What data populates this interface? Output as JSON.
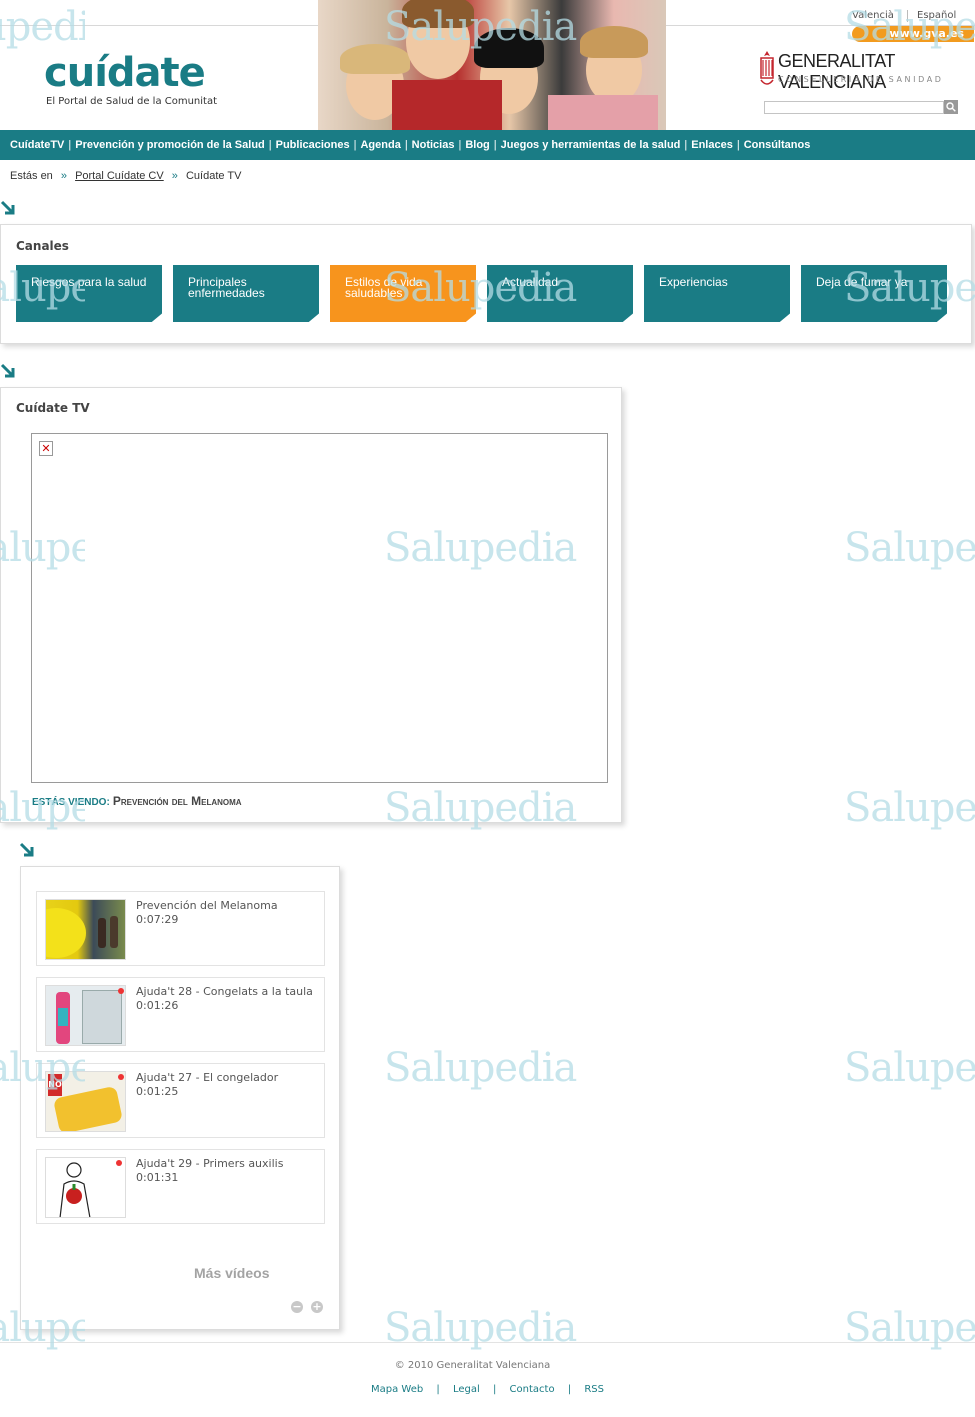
{
  "header": {
    "logo_title": "cuídate",
    "logo_subtitle": "El Portal de Salud de la Comunitat",
    "lang_valencia": "Valencià",
    "lang_espanol": "Español",
    "gva_link": "www.gva.es",
    "gv_title": "GENERALITAT VALENCIANA",
    "gv_subtitle": "CONSELLERIA DE SANIDAD",
    "search_placeholder": ""
  },
  "nav": {
    "items": [
      {
        "label": "CuídateTV"
      },
      {
        "label": "Prevención y promoción de la Salud"
      },
      {
        "label": "Publicaciones"
      },
      {
        "label": "Agenda"
      },
      {
        "label": "Noticias"
      },
      {
        "label": "Blog"
      },
      {
        "label": "Juegos y herramientas de la salud"
      },
      {
        "label": "Enlaces"
      },
      {
        "label": "Consúltanos"
      }
    ],
    "separator": "|"
  },
  "breadcrumb": {
    "prefix": "Estás en",
    "sep": "»",
    "link": "Portal Cuídate CV",
    "current": "Cuídate TV"
  },
  "channels": {
    "title": "Canales",
    "items": [
      {
        "label": "Riesgos para la salud",
        "active": false
      },
      {
        "label": "Principales enfermedades",
        "active": false
      },
      {
        "label": "Estilos de vida saludables",
        "active": true
      },
      {
        "label": "Actualidad",
        "active": false
      },
      {
        "label": "Experiencias",
        "active": false
      },
      {
        "label": "Deja de fumar ya",
        "active": false
      }
    ]
  },
  "tv": {
    "title": "Cuídate TV",
    "now_label": "Estás viendo",
    "now_colon": ":",
    "now_title": "Prevención del Melanoma"
  },
  "videos": {
    "items": [
      {
        "title": "Prevención del Melanoma",
        "duration": "0:07:29"
      },
      {
        "title": "Ajuda't 28 - Congelats a la taula",
        "duration": "0:01:26"
      },
      {
        "title": "Ajuda't 27 - El congelador",
        "duration": "0:01:25"
      },
      {
        "title": "Ajuda't 29 - Primers auxilis",
        "duration": "0:01:31"
      }
    ],
    "more_label": "Más vídeos",
    "prev_icon": "−",
    "next_icon": "+"
  },
  "footer": {
    "copyright": "© 2010 Generalitat Valenciana",
    "links": [
      "Mapa Web",
      "Legal",
      "Contacto",
      "RSS"
    ],
    "separator": "|"
  },
  "watermark": "Salupedia",
  "colors": {
    "brand_teal": "#1a7c85",
    "accent_orange": "#f7941d",
    "gva_orange": "#f29b1f"
  }
}
